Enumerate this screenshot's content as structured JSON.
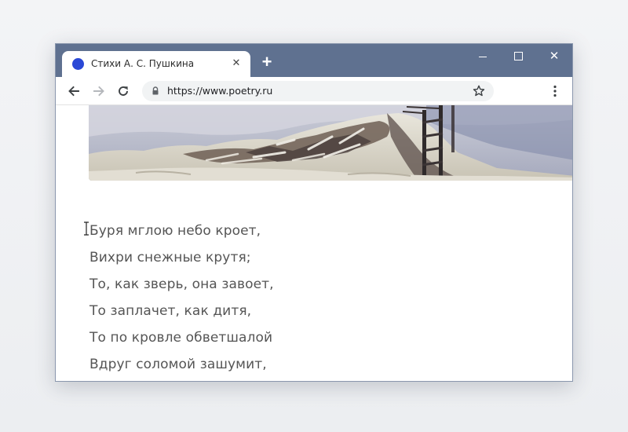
{
  "browser": {
    "tab": {
      "title": "Стихи А. С. Пушкина",
      "close_glyph": "✕",
      "favicon_color": "#2a48d6"
    },
    "new_tab_glyph": "+",
    "window_controls": {
      "close_glyph": "✕"
    },
    "address_bar": {
      "url": "https://www.poetry.ru"
    },
    "icons": {
      "back": "arrow-left-icon",
      "forward": "arrow-right-icon",
      "reload": "reload-icon",
      "lock": "lock-icon",
      "bookmark": "star-icon",
      "menu": "kebab-menu-icon"
    },
    "colors": {
      "titlebar": "#5f7190",
      "text": "#555555"
    }
  },
  "page": {
    "poem_lines": [
      "Буря мглою небо кроет,",
      "Вихри снежные крутя;",
      "То, как зверь, она завоет,",
      "То заплачет, как дитя,",
      "То по кровле обветшалой",
      "Вдруг соломой зашумит,"
    ]
  }
}
